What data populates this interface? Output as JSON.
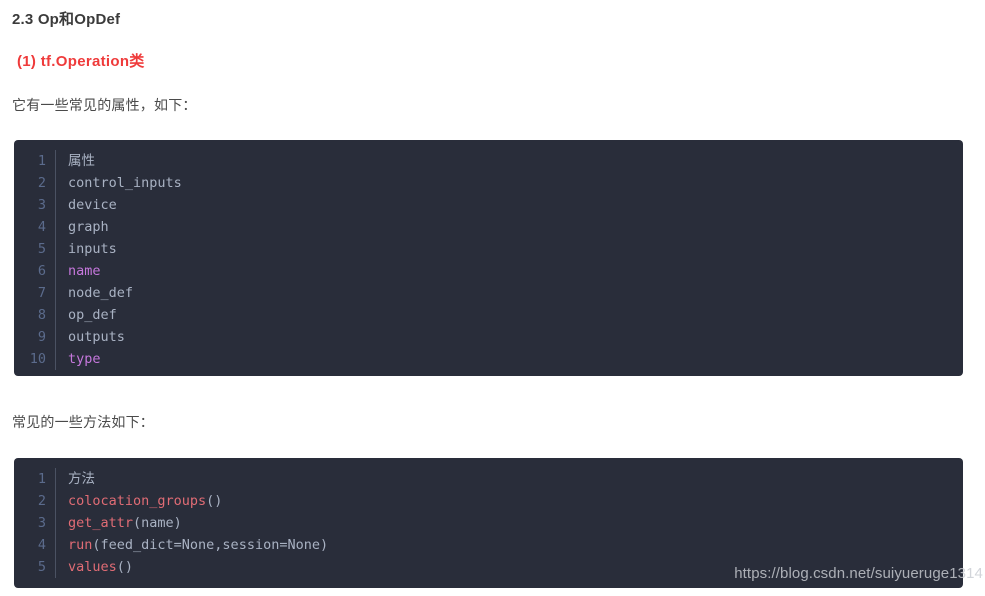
{
  "article": {
    "section_heading": "2.3 Op和OpDef",
    "sub_heading": "(1)  tf.Operation类",
    "paragraph_1": "它有一些常见的属性，如下：",
    "paragraph_2": "常见的一些方法如下："
  },
  "colors": {
    "heading": "#3b3b3b",
    "sub_heading_red": "#ef3b3b",
    "body_text": "#4a4a4a",
    "code_background": "#292d3a",
    "code_text": "#a9b2c3",
    "code_linenumber": "#5b6b8c",
    "code_keyword": "#c678dd",
    "code_function": "#e06c75",
    "watermark": "#c9ccd2"
  },
  "code_block_1": {
    "line_numbers": [
      "1",
      "2",
      "3",
      "4",
      "5",
      "6",
      "7",
      "8",
      "9",
      "10"
    ],
    "lines": [
      {
        "tokens": [
          {
            "text": "属性",
            "type": "cjk"
          }
        ]
      },
      {
        "tokens": [
          {
            "text": "control_inputs",
            "type": "plain"
          }
        ]
      },
      {
        "tokens": [
          {
            "text": "device",
            "type": "plain"
          }
        ]
      },
      {
        "tokens": [
          {
            "text": "graph",
            "type": "plain"
          }
        ]
      },
      {
        "tokens": [
          {
            "text": "inputs",
            "type": "plain"
          }
        ]
      },
      {
        "tokens": [
          {
            "text": "name",
            "type": "keyword"
          }
        ]
      },
      {
        "tokens": [
          {
            "text": "node_def",
            "type": "plain"
          }
        ]
      },
      {
        "tokens": [
          {
            "text": "op_def",
            "type": "plain"
          }
        ]
      },
      {
        "tokens": [
          {
            "text": "outputs",
            "type": "plain"
          }
        ]
      },
      {
        "tokens": [
          {
            "text": "type",
            "type": "keyword"
          }
        ]
      }
    ]
  },
  "code_block_2": {
    "line_numbers": [
      "1",
      "2",
      "3",
      "4",
      "5"
    ],
    "lines": [
      {
        "tokens": [
          {
            "text": "方法",
            "type": "cjk"
          }
        ]
      },
      {
        "tokens": [
          {
            "text": "colocation_groups",
            "type": "func"
          },
          {
            "text": "()",
            "type": "punct"
          }
        ]
      },
      {
        "tokens": [
          {
            "text": "get_attr",
            "type": "func"
          },
          {
            "text": "(name)",
            "type": "punct"
          }
        ]
      },
      {
        "tokens": [
          {
            "text": "run",
            "type": "func"
          },
          {
            "text": "(feed_dict=None,session=None)",
            "type": "punct"
          }
        ]
      },
      {
        "tokens": [
          {
            "text": "values",
            "type": "func"
          },
          {
            "text": "()",
            "type": "punct"
          }
        ]
      }
    ]
  },
  "watermark": {
    "text": "https://blog.csdn.net/suiyueruge1314"
  }
}
